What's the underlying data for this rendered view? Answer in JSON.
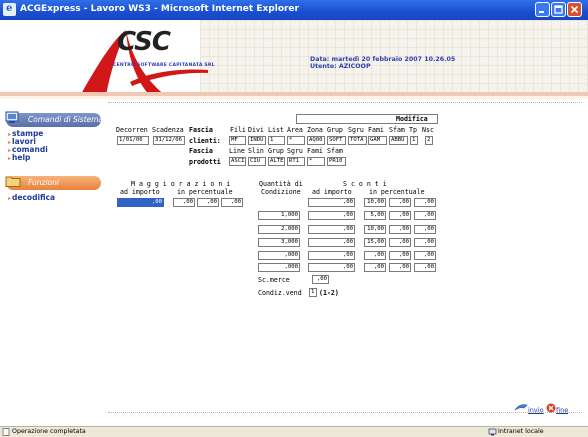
{
  "window": {
    "title": "ACGExpress - Lavoro WS3 - Microsoft Internet Explorer"
  },
  "header": {
    "logo_text": "CSC",
    "logo_subtitle": "CENTRO SOFTWARE CAPITANATA SRL",
    "date_line": "Data:   martedì 20 febbraio 2007 10.26.05",
    "user_line": "Utente: AZICOOP"
  },
  "sidebar": {
    "sections": [
      {
        "title": "Comandi di Sistema",
        "items": [
          "stampe",
          "lavori",
          "comandi",
          "help"
        ]
      },
      {
        "title": "Funzioni",
        "items": [
          "decodifica"
        ]
      }
    ]
  },
  "form": {
    "mode_label": "Modifica",
    "row1_headers": [
      "Decorren",
      "Scadenza",
      "Fascia",
      "Fili",
      "Divi",
      "List",
      "Area",
      "Zona",
      "Grup",
      "Sgru",
      "Fami",
      "Sfam",
      "Tp",
      "Nsc"
    ],
    "row1_second_label": "clienti:",
    "row1_values": {
      "decorrenza": "1/01/06",
      "scadenza": "31/12/06",
      "fili": "MF",
      "divi": "INDU",
      "list": "1",
      "area": "*",
      "zona": "AQ00",
      "grup": "SOFT",
      "sgru": "TOTA",
      "fami": "GAM",
      "sfam": "ABBU",
      "tp": "1",
      "nsc": "2"
    },
    "row2_label": "Fascia",
    "row2_headers": [
      "Line",
      "Slin",
      "Grup",
      "Sgru",
      "Fami",
      "Sfam"
    ],
    "row2_second_label": "prodotti",
    "row2_values": {
      "line": "ASCI",
      "slin": "CIU",
      "grup": "ALTE",
      "sgru": "RT1",
      "fami": "*",
      "sfam": "PR10"
    },
    "maggiorazioni": {
      "title": "M a g g i o r a z i o n i",
      "col1": "ad importo",
      "col2": "in percentuale",
      "importo": ",00",
      "percentuali": [
        ",00",
        ",00",
        ",00"
      ]
    },
    "quantita": {
      "title": "Quantità di",
      "subtitle": "Condizione",
      "values": [
        "1,000",
        "2,000",
        "3,000",
        ",000",
        ",000"
      ]
    },
    "sconti": {
      "title": "S c o n t i",
      "col1": "ad importo",
      "col2": "in percentuale",
      "rows": [
        {
          "importo": ",00",
          "perc": [
            "10,00",
            ",00",
            ",00"
          ]
        },
        {
          "importo": ",00",
          "perc": [
            "5,00",
            ",00",
            ",00"
          ]
        },
        {
          "importo": ",00",
          "perc": [
            "10,00",
            ",00",
            ",00"
          ]
        },
        {
          "importo": ",00",
          "perc": [
            "15,00",
            ",00",
            ",00"
          ]
        },
        {
          "importo": ",00",
          "perc": [
            ",00",
            ",00",
            ",00"
          ]
        },
        {
          "importo": ",00",
          "perc": [
            ",00",
            ",00",
            ",00"
          ]
        }
      ]
    },
    "sc_merce_label": "Sc.merce",
    "sc_merce_value": ",00",
    "condiz_label": "Condiz.vend",
    "condiz_value": "1",
    "condiz_hint": "(1-2)"
  },
  "actions": {
    "invio": "invio",
    "fine": "fine"
  },
  "statusbar": {
    "status": "Operazione completata",
    "zone": "Intranet locale"
  }
}
